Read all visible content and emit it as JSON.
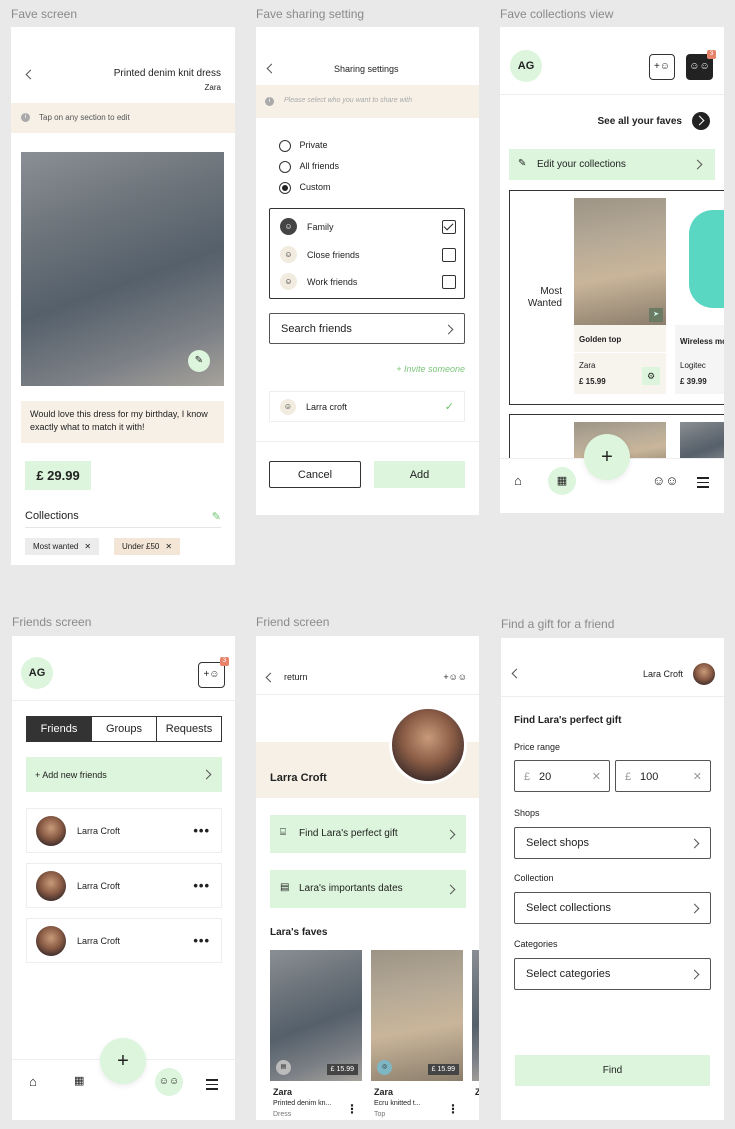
{
  "labels": {
    "fave_screen": "Fave screen",
    "sharing": "Fave sharing setting",
    "collections_view": "Fave collections view",
    "friends_screen": "Friends screen",
    "friend_screen": "Friend screen",
    "find_gift": "Find a gift for a friend"
  },
  "fave": {
    "title": "Printed denim knit dress",
    "brand": "Zara",
    "hint": "Tap on any section to edit",
    "note": "Would love this dress for my birthday, I know exactly what to match it with!",
    "price": "£ 29.99",
    "collections_label": "Collections",
    "tags": [
      "Most wanted",
      "Under £50"
    ]
  },
  "sharing": {
    "title": "Sharing settings",
    "hint": "Please select who you want to share with",
    "options": [
      "Private",
      "All friends",
      "Custom"
    ],
    "groups": [
      "Family",
      "Close friends",
      "Work friends"
    ],
    "search": "Search friends",
    "invite": "+ Invite someone",
    "friend": "Larra croft",
    "cancel": "Cancel",
    "add": "Add"
  },
  "collections": {
    "avatar": "AG",
    "badge": "3",
    "see_all": "See all your faves",
    "edit": "Edit your collections",
    "group_label": "Most Wanted",
    "items": [
      {
        "name": "Golden top",
        "brand": "Zara",
        "price": "£ 15.99"
      },
      {
        "name": "Wireless mo",
        "brand": "Logitec",
        "price": "£ 39.99"
      }
    ]
  },
  "friends": {
    "avatar": "AG",
    "badge": "3",
    "tabs": [
      "Friends",
      "Groups",
      "Requests"
    ],
    "add": "+ Add new friends",
    "list": [
      "Larra Croft",
      "Larra Croft",
      "Larra Croft"
    ],
    "dots": "•••"
  },
  "friend": {
    "return": "return",
    "add_icon": "+",
    "name": "Larra Croft",
    "actions": [
      "Find Lara's perfect gift",
      "Lara's importants dates"
    ],
    "faves_title": "Lara's faves",
    "faves": [
      {
        "price": "£ 15.99",
        "brand": "Zara",
        "name": "Printed denim kn...",
        "type": "Dress"
      },
      {
        "price": "£ 15.99",
        "brand": "Zara",
        "name": "Ecru knitted t...",
        "type": "Top"
      }
    ],
    "partial_brand": "Z"
  },
  "gift": {
    "name": "Lara Croft",
    "title": "Find Lara's perfect gift",
    "price_label": "Price range",
    "currency": "£",
    "min": "20",
    "max": "100",
    "shops_label": "Shops",
    "shops": "Select shops",
    "collection_label": "Collection",
    "collection": "Select collections",
    "categories_label": "Categories",
    "categories": "Select categories",
    "find": "Find"
  },
  "colors": {
    "accent": "#dcf5dc",
    "cream": "#f6f0e7",
    "badge": "#e7836b",
    "dark": "#222222"
  }
}
